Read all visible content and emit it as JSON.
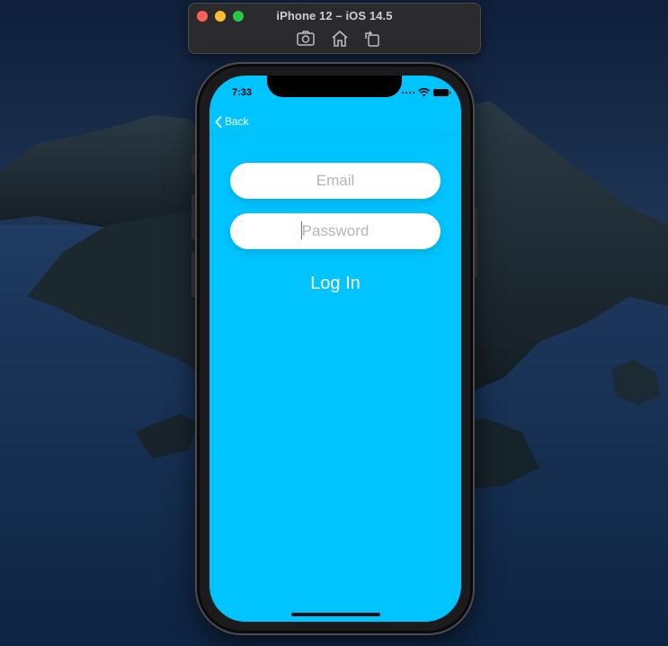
{
  "window": {
    "title": "iPhone 12 – iOS 14.5",
    "toolbar_icons": [
      "screenshot-icon",
      "home-icon",
      "rotate-icon"
    ],
    "traffic_lights": {
      "close": "#ff5f57",
      "minimize": "#febc2e",
      "zoom": "#28c840"
    }
  },
  "status_bar": {
    "time": "7:33",
    "icons": [
      "signal-icon",
      "wifi-icon",
      "battery-icon"
    ]
  },
  "nav": {
    "back_label": "Back",
    "back_icon": "chevron-left-icon"
  },
  "form": {
    "email": {
      "value": "",
      "placeholder": "Email"
    },
    "password": {
      "value": "",
      "placeholder": "Password"
    },
    "login_label": "Log In"
  },
  "colors": {
    "screen_background": "#00c4ff",
    "field_background": "#ffffff",
    "login_text": "#ffffff",
    "placeholder": "#b5b5ba"
  }
}
